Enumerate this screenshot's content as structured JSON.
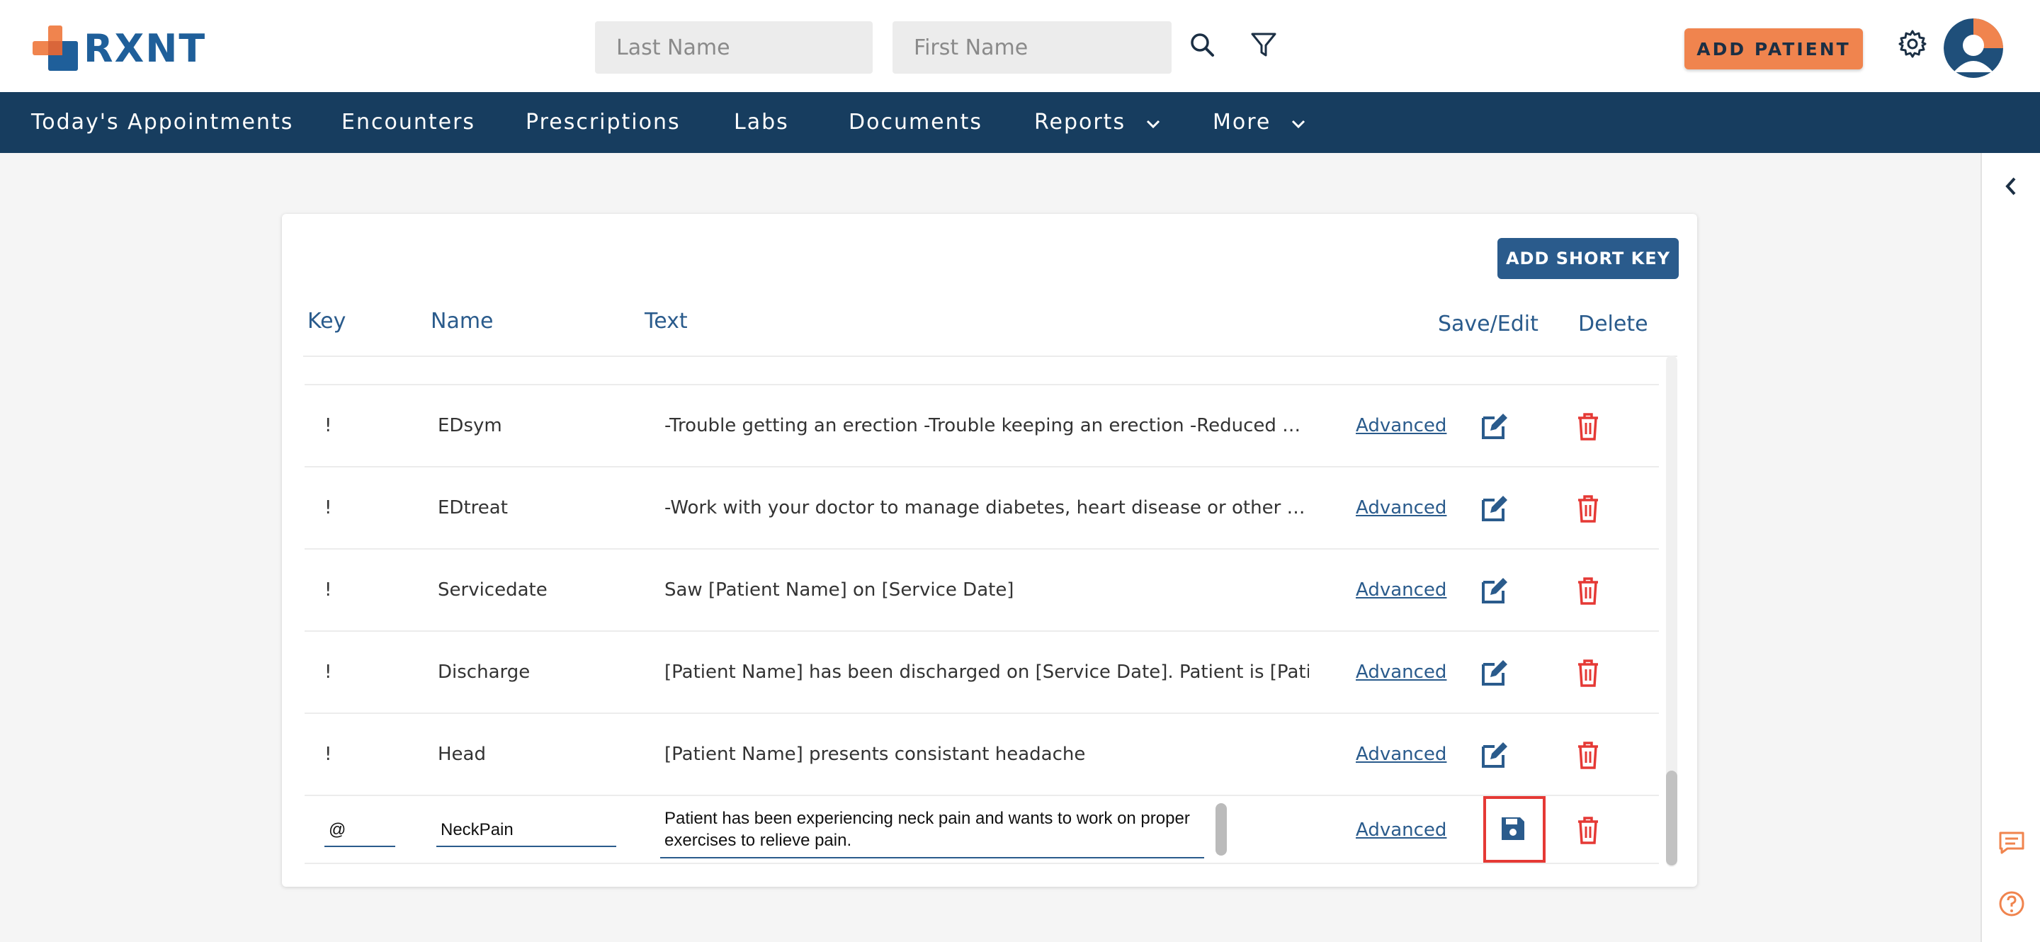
{
  "header": {
    "logo_text": "RXNT",
    "last_name_placeholder": "Last Name",
    "first_name_placeholder": "First Name",
    "add_patient_label": "ADD PATIENT"
  },
  "nav": {
    "items": [
      {
        "label": "Today's Appointments"
      },
      {
        "label": "Encounters"
      },
      {
        "label": "Prescriptions"
      },
      {
        "label": "Labs"
      },
      {
        "label": "Documents"
      },
      {
        "label": "Reports"
      },
      {
        "label": "More"
      }
    ]
  },
  "card": {
    "add_short_key_label": "ADD SHORT KEY",
    "columns": {
      "key": "Key",
      "name": "Name",
      "text": "Text",
      "save_edit": "Save/Edit",
      "delete": "Delete"
    },
    "rows": [
      {
        "key": "!",
        "name": "EDsym",
        "text": "-Trouble getting an erection -Trouble keeping an erection -Reduced sexual desire",
        "advanced": "Advanced"
      },
      {
        "key": "!",
        "name": "EDtreat",
        "text": "-Work with your doctor to manage diabetes, heart disease or other chronic health conditions",
        "advanced": "Advanced"
      },
      {
        "key": "!",
        "name": "Servicedate",
        "text": "Saw [Patient Name] on [Service Date]",
        "advanced": "Advanced"
      },
      {
        "key": "!",
        "name": "Discharge",
        "text": "[Patient Name] has been discharged on [Service Date]. Patient is [Patient A",
        "advanced": "Advanced"
      },
      {
        "key": "!",
        "name": "Head",
        "text": "[Patient Name] presents consistant headache",
        "advanced": "Advanced"
      }
    ],
    "edit_row": {
      "key": "@",
      "name": "NeckPain",
      "text": "Patient has been experiencing neck pain and wants to work on proper exercises to relieve pain.",
      "advanced": "Advanced"
    }
  },
  "colors": {
    "brand_blue": "#1f5f9a",
    "nav_bg": "#173d5f",
    "accent_orange": "#f0844e",
    "delete_red": "#e53935"
  }
}
